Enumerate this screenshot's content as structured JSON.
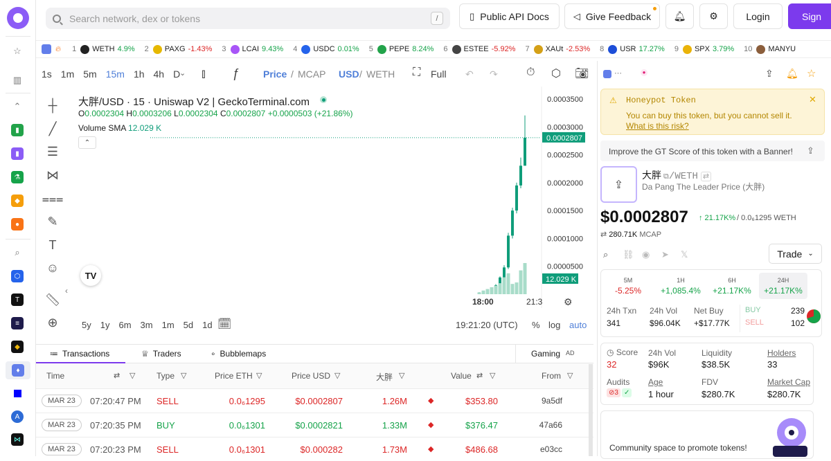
{
  "search": {
    "placeholder": "Search network, dex or tokens",
    "shortcut": "/"
  },
  "topbar": {
    "api_docs": "Public API Docs",
    "feedback": "Give Feedback",
    "login": "Login",
    "signup": "Sign"
  },
  "ticker": [
    {
      "rank": "1",
      "symbol": "WETH",
      "change": "4.9%",
      "dir": "up",
      "color": "#222222"
    },
    {
      "rank": "2",
      "symbol": "PAXG",
      "change": "-1.43%",
      "dir": "dn",
      "color": "#e6b800"
    },
    {
      "rank": "3",
      "symbol": "LCAI",
      "change": "9.43%",
      "dir": "up",
      "color": "#a855f7"
    },
    {
      "rank": "4",
      "symbol": "USDC",
      "change": "0.01%",
      "dir": "up",
      "color": "#2563eb"
    },
    {
      "rank": "5",
      "symbol": "PEPE",
      "change": "8.24%",
      "dir": "up",
      "color": "#22a34a"
    },
    {
      "rank": "6",
      "symbol": "ESTEE",
      "change": "-5.92%",
      "dir": "dn",
      "color": "#444444"
    },
    {
      "rank": "7",
      "symbol": "XAUt",
      "change": "-2.53%",
      "dir": "dn",
      "color": "#d4a017"
    },
    {
      "rank": "8",
      "symbol": "USR",
      "change": "17.27%",
      "dir": "up",
      "color": "#1d4ed8"
    },
    {
      "rank": "9",
      "symbol": "SPX",
      "change": "3.79%",
      "dir": "up",
      "color": "#eab308"
    },
    {
      "rank": "10",
      "symbol": "MANYU",
      "change": "",
      "dir": "up",
      "color": "#8b5e3c"
    }
  ],
  "chart_toolbar": {
    "intervals": [
      "1s",
      "1m",
      "5m",
      "15m",
      "1h",
      "4h",
      "D"
    ],
    "active_interval": "15m",
    "price": "Price",
    "mcap": "MCAP",
    "usd": "USD",
    "weth": "WETH",
    "full": "Full"
  },
  "chart": {
    "title": "大胖/USD · 15 · Uniswap V2 | GeckoTerminal.com",
    "o_label": "O",
    "o": "0.0002304",
    "h_label": "H",
    "h": "0.0003206",
    "l_label": "L",
    "l": "0.0002304",
    "c_label": "C",
    "c": "0.0002807",
    "change": "+0.0000503 (+21.86%)",
    "volume_label": "Volume SMA",
    "volume_value": "12.029 K",
    "price_tag": "0.0002807",
    "volume_tag": "12.029 K",
    "time_label_1": "18:00",
    "time_label_2": "21:3",
    "ranges": [
      "5y",
      "1y",
      "6m",
      "3m",
      "1m",
      "5d",
      "1d"
    ],
    "clock": "19:21:20 (UTC)",
    "pct": "%",
    "log": "log",
    "auto": "auto"
  },
  "chart_data": {
    "type": "candlestick",
    "title": "大胖/USD · 15 · Uniswap V2 | GeckoTerminal.com",
    "y_ticks": [
      "0.0003500",
      "0.0003000",
      "0.0002500",
      "0.0002000",
      "0.0001500",
      "0.0001000",
      "0.0000500"
    ],
    "y_tick_values": [
      0.00035,
      0.0003,
      0.00025,
      0.0002,
      0.00015,
      0.0001,
      5e-05
    ],
    "ylim": [
      0.0,
      0.00036
    ],
    "x_ticks": [
      "18:00",
      "21:3"
    ],
    "candles": [
      {
        "o": 1e-06,
        "h": 3.5e-06,
        "l": 5e-07,
        "c": 2e-06
      },
      {
        "o": 2e-06,
        "h": 6e-06,
        "l": 1.5e-06,
        "c": 4.5e-06
      },
      {
        "o": 4.5e-06,
        "h": 9e-06,
        "l": 4e-06,
        "c": 7.5e-06
      },
      {
        "o": 7.5e-06,
        "h": 1.2e-05,
        "l": 7e-06,
        "c": 1.05e-05
      },
      {
        "o": 1.05e-05,
        "h": 1.8e-05,
        "l": 1e-05,
        "c": 1.6e-05
      },
      {
        "o": 1.6e-05,
        "h": 3.2e-05,
        "l": 1.5e-05,
        "c": 3e-05
      },
      {
        "o": 3e-05,
        "h": 5.2e-05,
        "l": 2.8e-05,
        "c": 4.8e-05
      },
      {
        "o": 4.8e-05,
        "h": 0.00011,
        "l": 4.5e-05,
        "c": 0.000105
      },
      {
        "o": 0.000105,
        "h": 0.000155,
        "l": 0.0001,
        "c": 0.00015
      },
      {
        "o": 0.00015,
        "h": 0.0002,
        "l": 0.000145,
        "c": 0.000195
      },
      {
        "o": 0.000195,
        "h": 0.000245,
        "l": 0.00019,
        "c": 0.0002304
      },
      {
        "o": 0.0002304,
        "h": 0.0003206,
        "l": 0.0002304,
        "c": 0.0002807
      }
    ],
    "volumes": [
      0.5,
      1.0,
      1.4,
      1.9,
      2.3,
      3.0,
      4.6,
      5.7,
      2.8,
      3.2,
      6.5,
      8.5
    ]
  },
  "tabs": {
    "transactions": "Transactions",
    "traders": "Traders",
    "bubblemaps": "Bubblemaps",
    "gaming": "Gaming",
    "ad": "AD"
  },
  "table": {
    "headers": [
      "Time",
      "Type",
      "Price ETH",
      "Price USD",
      "大胖",
      "Value",
      "From"
    ],
    "rows": [
      {
        "date": "MAR 23",
        "time": "07:20:47 PM",
        "type": "SELL",
        "price_eth": "0.0₆1295",
        "price_usd": "$0.0002807",
        "amount": "1.26M",
        "value": "$353.80",
        "from": "9a5df"
      },
      {
        "date": "MAR 23",
        "time": "07:20:35 PM",
        "type": "BUY",
        "price_eth": "0.0₆1301",
        "price_usd": "$0.0002821",
        "amount": "1.33M",
        "value": "$376.47",
        "from": "47a66"
      },
      {
        "date": "MAR 23",
        "time": "07:20:23 PM",
        "type": "SELL",
        "price_eth": "0.0₆1301",
        "price_usd": "$0.000282",
        "amount": "1.73M",
        "value": "$486.68",
        "from": "e03cc"
      }
    ]
  },
  "panel": {
    "honeypot_title": "Honeypot Token",
    "honeypot_text": "You can buy this token, but you cannot sell it.",
    "honeypot_link": "What is this risk?",
    "banner": "Improve the GT Score of this token with a Banner!",
    "token_symbol": "大胖",
    "token_pair": "/WETH",
    "token_name": "Da Pang The Leader Price (大胖)",
    "price": "$0.0002807",
    "price_change": "↑ 21.17K%",
    "price_weth": "/ 0.0₆1295 WETH",
    "mcap_value": "280.71K",
    "mcap_label": "MCAP",
    "trade": "Trade",
    "periods": [
      {
        "label": "5M",
        "change": "-5.25%",
        "dir": "dn"
      },
      {
        "label": "1H",
        "change": "+1,085.4%",
        "dir": "up"
      },
      {
        "label": "6H",
        "change": "+21.17K%",
        "dir": "up"
      },
      {
        "label": "24H",
        "change": "+21.17K%",
        "dir": "up"
      }
    ],
    "txn_label": "24h Txn",
    "txn_value": "341",
    "vol_label": "24h Vol",
    "vol_value": "$96.04K",
    "netbuy_label": "Net Buy",
    "netbuy_value": "+$17.77K",
    "buy_label": "BUY",
    "buy_value": "239",
    "sell_label": "SELL",
    "sell_value": "102",
    "score_label": "Score",
    "score_value": "32",
    "vol2_label": "24h Vol",
    "vol2_value": "$96K",
    "liq_label": "Liquidity",
    "liq_value": "$38.5K",
    "holders_label": "Holders",
    "holders_value": "33",
    "audits_label": "Audits",
    "audits_warn": "3",
    "age_label": "Age",
    "age_value": "1 hour",
    "fdv_label": "FDV",
    "fdv_value": "$280.7K",
    "mcap2_label": "Market Cap",
    "mcap2_value": "$280.7K",
    "community": "Community space to promote tokens!"
  },
  "colors": {
    "accent": "#7c3aed",
    "up": "#16a34a",
    "down": "#dc2626",
    "candle": "#0f9d7a",
    "warn_bg": "#fdf4d7"
  }
}
